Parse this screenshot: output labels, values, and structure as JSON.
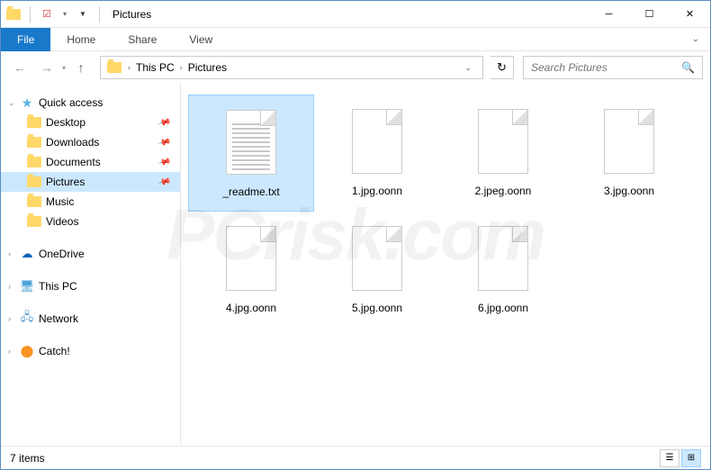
{
  "title": "Pictures",
  "ribbon": {
    "file": "File",
    "tabs": [
      "Home",
      "Share",
      "View"
    ]
  },
  "breadcrumbs": [
    "This PC",
    "Pictures"
  ],
  "search_placeholder": "Search Pictures",
  "sidebar": {
    "quick": {
      "label": "Quick access",
      "items": [
        {
          "label": "Desktop",
          "pinned": true
        },
        {
          "label": "Downloads",
          "pinned": true
        },
        {
          "label": "Documents",
          "pinned": true
        },
        {
          "label": "Pictures",
          "pinned": true,
          "selected": true
        },
        {
          "label": "Music"
        },
        {
          "label": "Videos"
        }
      ]
    },
    "roots": [
      {
        "label": "OneDrive",
        "icon": "cloud"
      },
      {
        "label": "This PC",
        "icon": "pc"
      },
      {
        "label": "Network",
        "icon": "network"
      },
      {
        "label": "Catch!",
        "icon": "catch"
      }
    ]
  },
  "files": [
    {
      "name": "_readme.txt",
      "type": "txt",
      "selected": true
    },
    {
      "name": "1.jpg.oonn",
      "type": "blank"
    },
    {
      "name": "2.jpeg.oonn",
      "type": "blank"
    },
    {
      "name": "3.jpg.oonn",
      "type": "blank"
    },
    {
      "name": "4.jpg.oonn",
      "type": "blank"
    },
    {
      "name": "5.jpg.oonn",
      "type": "blank"
    },
    {
      "name": "6.jpg.oonn",
      "type": "blank"
    }
  ],
  "status": "7 items"
}
